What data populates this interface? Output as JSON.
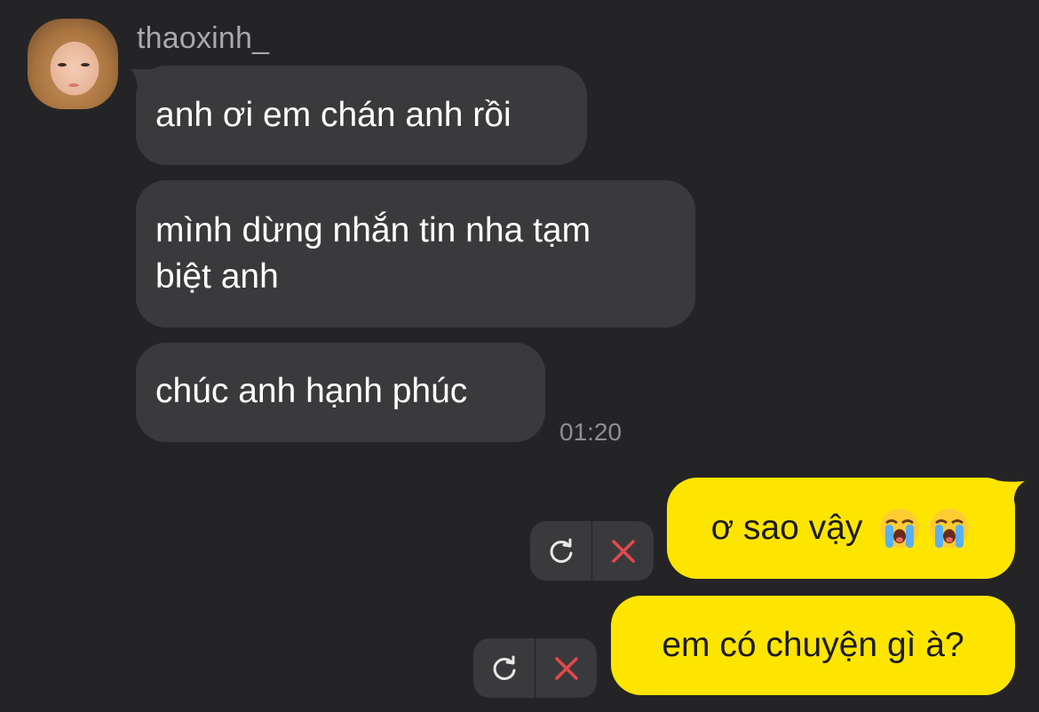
{
  "sender": {
    "username": "thaoxinh_"
  },
  "incoming": [
    {
      "lines": [
        "anh ơi em chán anh rồi"
      ]
    },
    {
      "lines": [
        "mình dừng nhắn tin nha tạm",
        "biệt anh"
      ]
    },
    {
      "lines": [
        "chúc anh hạnh phúc"
      ]
    }
  ],
  "incoming_time": "01:20",
  "outgoing": [
    {
      "text": "ơ sao vậy",
      "emoji": [
        "loudly-crying-face-icon",
        "loudly-crying-face-icon"
      ]
    },
    {
      "text": "em có chuyện gì à?"
    }
  ],
  "colors": {
    "background": "#242426",
    "incoming_bubble": "#3a3a3c",
    "outgoing_bubble": "#fee500",
    "delete_x": "#e5484d"
  }
}
